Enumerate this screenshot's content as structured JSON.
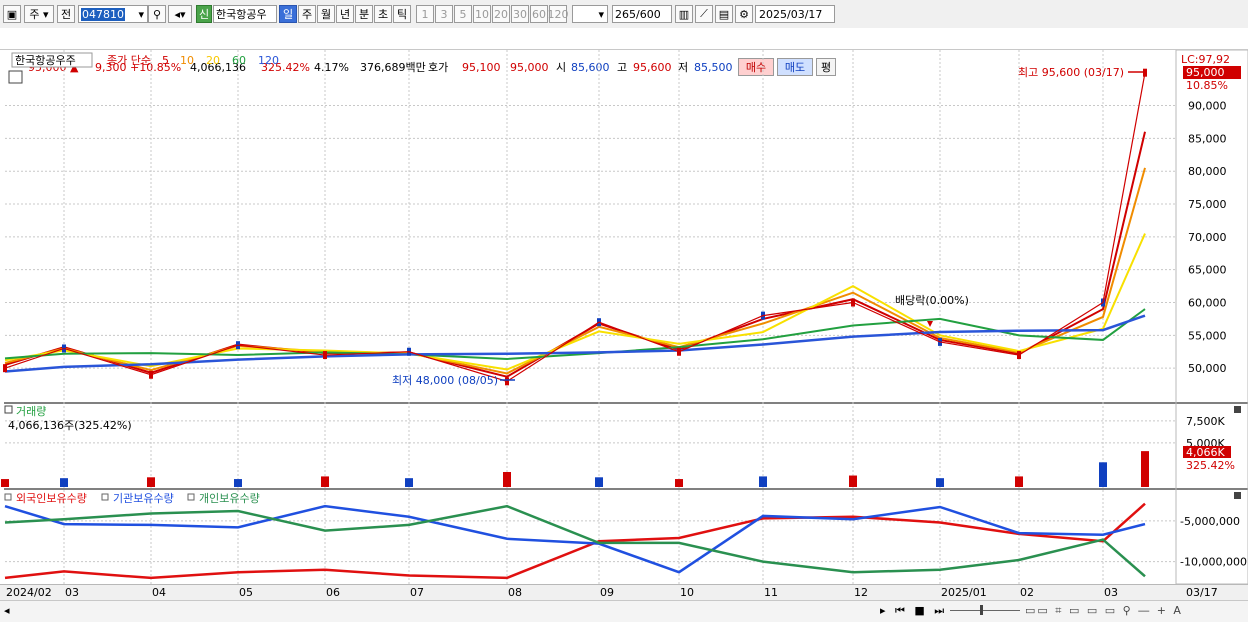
{
  "toolbar": {
    "market": "주",
    "prev_label": "전",
    "code": "047810",
    "stock_name": "한국항공우",
    "new_badge": "신",
    "periods": [
      "일",
      "주",
      "월",
      "년",
      "분",
      "초",
      "틱"
    ],
    "active_period": "일",
    "intervals": [
      "1",
      "3",
      "5",
      "10",
      "20",
      "30",
      "60",
      "120"
    ],
    "count": "265",
    "count_total": "/600",
    "date": "2025/03/17"
  },
  "quote": {
    "price": "95,000",
    "change": "9,300",
    "change_pct": "+10.85%",
    "volume": "4,066,136",
    "volume_ratio": "325.42%",
    "turnover": "4.17%",
    "amount": "376,689백만",
    "bid_label": "호가",
    "bid": "95,100",
    "ask": "95,000",
    "open_label": "시",
    "open": "85,600",
    "high_label": "고",
    "high": "95,600",
    "low_label": "저",
    "low": "85,500",
    "buy_label": "매수",
    "sell_label": "매도",
    "eval_label": "평"
  },
  "price_panel": {
    "stock_label": "한국항공우주",
    "ma_label": "종가 단순",
    "ma_periods": [
      "5",
      "10",
      "20",
      "60",
      "120"
    ],
    "lc": "LC:97,92",
    "last_price_tag": "95,000",
    "last_change_tag": "10.85%",
    "high_annotation": "최고 95,600 (03/17)",
    "low_annotation": "최저 48,000 (08/05)",
    "dividend_annotation": "배당락(0.00%)",
    "y_ticks": [
      "90,000",
      "85,000",
      "80,000",
      "75,000",
      "70,000",
      "65,000",
      "60,000",
      "55,000",
      "50,000"
    ]
  },
  "volume_panel": {
    "title": "거래량",
    "current": "4,066,136주(325.42%)",
    "y_ticks": [
      "7,500K",
      "5,000K"
    ],
    "last_tag": "4,066K",
    "last_pct_tag": "325.42%"
  },
  "holdings_panel": {
    "legend": [
      "외국인보유수량",
      "기관보유수량",
      "개인보유수량"
    ],
    "y_ticks": [
      "-5,000,000",
      "-10,000,000"
    ]
  },
  "x_axis": {
    "labels": [
      "2024/02",
      "03",
      "04",
      "05",
      "06",
      "07",
      "08",
      "09",
      "10",
      "11",
      "12",
      "2025/01",
      "02",
      "03"
    ],
    "end_label": "03/17"
  },
  "chart_data": [
    {
      "type": "line",
      "title": "한국항공우주",
      "ylabel": "",
      "x": [
        "2024/02",
        "03",
        "04",
        "05",
        "06",
        "07",
        "08",
        "09",
        "10",
        "11",
        "12",
        "2025/01",
        "02",
        "03",
        "03/17"
      ],
      "ylim": [
        45000,
        98000
      ],
      "series": [
        {
          "name": "종가",
          "values": [
            50000,
            53000,
            49000,
            53500,
            52000,
            52500,
            48000,
            57000,
            52500,
            58000,
            60000,
            54000,
            52000,
            60000,
            95000
          ]
        },
        {
          "name": "5",
          "values": [
            50500,
            53200,
            49300,
            53600,
            52300,
            52400,
            48700,
            56800,
            52800,
            57500,
            60500,
            54300,
            52200,
            59000,
            86000
          ]
        },
        {
          "name": "10",
          "values": [
            50800,
            53000,
            49700,
            53400,
            52500,
            52300,
            49200,
            56300,
            53200,
            56800,
            61500,
            54600,
            52400,
            57800,
            80500
          ]
        },
        {
          "name": "20",
          "values": [
            51200,
            52700,
            50300,
            53000,
            52700,
            52200,
            49800,
            55600,
            53700,
            55500,
            62500,
            55000,
            52600,
            56000,
            70500
          ]
        },
        {
          "name": "60",
          "values": [
            51500,
            52200,
            52300,
            52000,
            52400,
            52100,
            51400,
            52300,
            53200,
            54400,
            56500,
            57500,
            55000,
            54300,
            59000
          ]
        },
        {
          "name": "120",
          "values": [
            49500,
            50200,
            50600,
            51300,
            51800,
            52100,
            52200,
            52400,
            52700,
            53600,
            54800,
            55500,
            55700,
            55800,
            58000
          ]
        }
      ]
    },
    {
      "type": "bar",
      "title": "거래량",
      "x": [
        "2024/02",
        "03",
        "04",
        "05",
        "06",
        "07",
        "08",
        "09",
        "10",
        "11",
        "12",
        "2025/01",
        "02",
        "03",
        "03/17"
      ],
      "ylim": [
        0,
        8500
      ],
      "series": [
        {
          "name": "거래량",
          "values": [
            900,
            1000,
            1100,
            900,
            1200,
            1000,
            1700,
            1100,
            900,
            1200,
            1300,
            1000,
            1200,
            2800,
            4066
          ]
        }
      ]
    },
    {
      "type": "line",
      "title": "",
      "x": [
        "2024/02",
        "03",
        "04",
        "05",
        "06",
        "07",
        "08",
        "09",
        "10",
        "11",
        "12",
        "2025/01",
        "02",
        "03",
        "03/17"
      ],
      "ylim": [
        -12500000,
        -2200000
      ],
      "series": [
        {
          "name": "외국인보유수량",
          "values": [
            -12000000,
            -11200000,
            -12000000,
            -11300000,
            -11000000,
            -11700000,
            -12000000,
            -7500000,
            -7100000,
            -4700000,
            -4500000,
            -5200000,
            -6600000,
            -7500000,
            -2900000
          ]
        },
        {
          "name": "기관보유수량",
          "values": [
            -3200000,
            -5400000,
            -5500000,
            -5800000,
            -3200000,
            -4500000,
            -7200000,
            -7800000,
            -11300000,
            -4400000,
            -4800000,
            -3300000,
            -6500000,
            -6700000,
            -5400000
          ]
        },
        {
          "name": "개인보유수량",
          "values": [
            -5200000,
            -4800000,
            -4100000,
            -3800000,
            -6200000,
            -5500000,
            -3200000,
            -7700000,
            -7700000,
            -10000000,
            -11300000,
            -11000000,
            -9800000,
            -7300000,
            -11800000
          ]
        }
      ]
    }
  ]
}
